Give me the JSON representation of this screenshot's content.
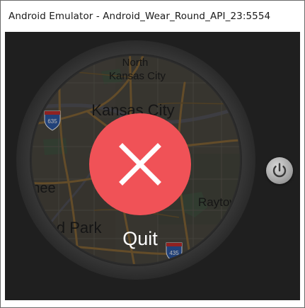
{
  "window": {
    "title": "Android Emulator - Android_Wear_Round_API_23:5554"
  },
  "map": {
    "labels": {
      "north_kansas_city_line1": "North",
      "north_kansas_city_line2": "Kansas City",
      "kansas_city": "Kansas City",
      "raytown": "Raytown",
      "lenexa_partial": "vnee",
      "overland_park_partial": "land Park"
    },
    "shields": {
      "i635_top": "635",
      "i435_bottom": "435"
    }
  },
  "dialog": {
    "quit_label": "Quit",
    "button_color": "#f05257"
  },
  "icons": {
    "close": "close-icon",
    "power": "power-icon"
  }
}
